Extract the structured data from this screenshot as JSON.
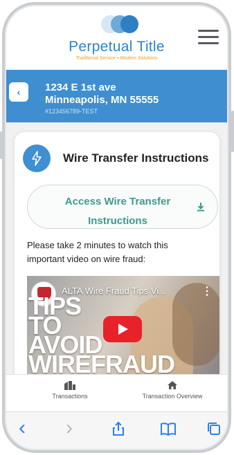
{
  "brand": {
    "name": "Perpetual Title",
    "tagline": "Traditional Service • Modern Solutions",
    "colors": {
      "primary": "#2d84c8",
      "accent": "#eaa21a",
      "header_bar": "#3e8ed0",
      "teal": "#3d9a8c"
    }
  },
  "header": {
    "menu_icon": "hamburger-menu-icon"
  },
  "property": {
    "back_icon": "chevron-left-icon",
    "back_label": "‹",
    "address_line1": "1234 E 1st ave",
    "address_line2": "Minneapolis, MN 55555",
    "file_number": "#123456789-TEST"
  },
  "card": {
    "icon": "lightning-bolt-icon",
    "title": "Wire Transfer Instructions",
    "access_button_line1": "Access Wire Transfer",
    "access_button_line2": "Instructions",
    "access_button_icon": "download-icon",
    "video_prompt": "Please take 2 minutes to watch this important video on wire fraud:",
    "video": {
      "title": "ALTA Wire Fraud Tips Vi...",
      "more_label": "⋮",
      "headline_line1": "TIPS",
      "headline_line2": "TO",
      "headline_line3": "AVOID",
      "headline_line4": "WIREFRAUD"
    }
  },
  "tabs": [
    {
      "label": "Transactions",
      "icon": "buildings-icon"
    },
    {
      "label": "Transaction Overview",
      "icon": "home-icon"
    }
  ],
  "browser_toolbar": {
    "back_label": "‹",
    "forward_label": "›",
    "icons": [
      "back-icon",
      "forward-icon",
      "share-icon",
      "bookmarks-icon",
      "tabs-icon"
    ]
  }
}
